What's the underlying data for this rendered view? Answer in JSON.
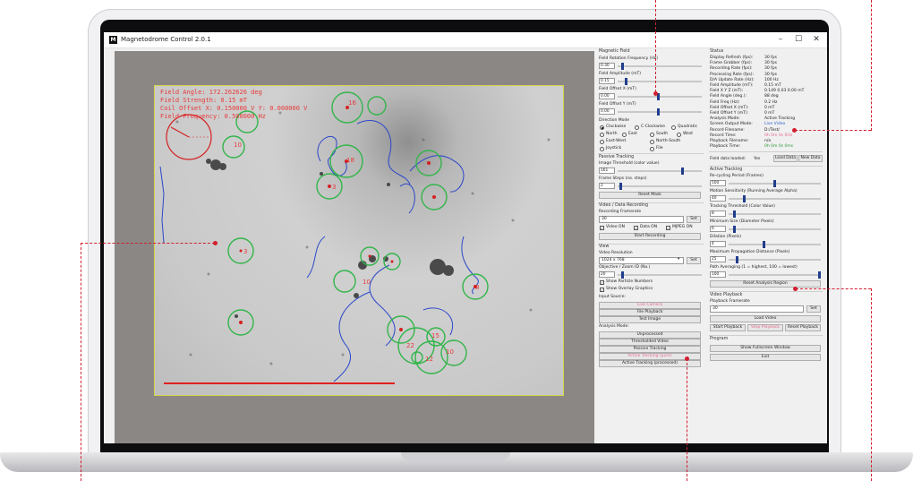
{
  "window": {
    "title": "Magnetodrome Control 2.0.1",
    "logo": "M",
    "minimize": "–",
    "maximize": "☐",
    "close": "✕"
  },
  "overlay": [
    "Field Angle: 172.262626 deg",
    "Field Strength: 0.15 mT",
    "Coil Offset X: 0.150000 V  Y: 0.000000 V",
    "Field Frequency: 0.500000 Hz"
  ],
  "particle_labels": [
    "16",
    "10",
    "18",
    "3",
    "10",
    "22",
    "15",
    "12",
    "10",
    "3",
    "8"
  ],
  "magnetic_field": {
    "title": "Magnetic Field",
    "rot_freq_label": "Field Rotation Frequency (Hz)",
    "rot_freq_value": "0.30",
    "amplitude_label": "Field Amplitude (mT)",
    "amplitude_value": "0.15",
    "offset_x_label": "Field Offset X (mT)",
    "offset_x_value": "0.00",
    "offset_y_label": "Field Offset Y (mT)",
    "offset_y_value": "0.00",
    "direction_label": "Direction Mode",
    "directions": [
      "Clockwise",
      "C-Clockwise",
      "Quadratic",
      "North",
      "East",
      "South",
      "West",
      "East-West",
      "North-South",
      "Joystick",
      "File"
    ]
  },
  "passive_tracking": {
    "title": "Passive Tracking",
    "threshold_label": "Image Threshold (color value)",
    "threshold_value": "161",
    "frame_steps_label": "Frame Steps (no. steps)",
    "frame_steps_value": "2",
    "reset_mask": "Reset Mask"
  },
  "recording": {
    "title": "Video / Data Recording",
    "framerate_label": "Recording Framerate",
    "framerate_value": "30",
    "set": "Set",
    "video_on": "Video ON",
    "data_on": "Data ON",
    "mjpeg_on": "MJPEG ON",
    "start": "Start Recording"
  },
  "view": {
    "title": "View",
    "resolution_label": "Video Resolution",
    "resolution_value": "1024 x 768",
    "set": "Set",
    "objective_label": "Objective / Zoom ID (No.)",
    "objective_value": "20",
    "show_numbers": "Show Particle Numbers",
    "show_overlay": "Show Overlay Graphics",
    "input_source": "Input Source:",
    "live_camera": "Live Camera",
    "file_playback": "File Playback",
    "test_image": "Test Image",
    "analysis_mode": "Analysis Mode:",
    "unprocessed": "Unprocessed",
    "thresholded": "Thresholded Video",
    "passive": "Passive Tracking",
    "active_pure": "Active Tracking (pure)",
    "active_processed": "Active Tracking (processed)"
  },
  "status": {
    "title": "Status",
    "rows": [
      [
        "Display Refresh (fps):",
        "30 fps"
      ],
      [
        "Frame Grabber (fps):",
        "30 fps"
      ],
      [
        "Recording Rate (fps):",
        "30 fps"
      ],
      [
        "Processing Rate (fps):",
        "30 fps"
      ],
      [
        "D/A Update Rate (Hz):",
        "100 Hz"
      ],
      [
        "Field Amplitude (mT):",
        "0.15 mT"
      ],
      [
        "Field X Y Z (mT):",
        "0.149 0.03 0.00 mT"
      ],
      [
        "Field Angle (deg.):",
        "88 deg"
      ],
      [
        "Field Freq (Hz):",
        "0.2 Hz"
      ],
      [
        "Field Offset X (mT):",
        "0 mT"
      ],
      [
        "Field Offset Y (mT):",
        "0 mT"
      ],
      [
        "Analysis Mode:",
        "Active Tracking"
      ],
      [
        "Screen Output Mode:",
        "Live Video"
      ],
      [
        "Record Filename:",
        "D:/Test/"
      ],
      [
        "Record Time:",
        "0h 0m 0s 0Hz"
      ],
      [
        "Playback Filename:",
        "n/a"
      ],
      [
        "Playback Time:",
        "0h 0m 0s 0ms"
      ]
    ],
    "data_loaded_label": "Field data loaded:",
    "data_loaded_value": "Yes",
    "load_data": "Load Data",
    "new_data": "New Data"
  },
  "active_tracking": {
    "title": "Active Tracking",
    "recycling_label": "Re-cycling Period (Frames)",
    "recycling_value": "500",
    "motion_label": "Motion Sensitivity (Running Average Alpha)",
    "motion_value": "40",
    "threshold_label": "Tracking Threshold (Color Value)",
    "threshold_value": "8",
    "minsize_label": "Minimum Size (Diameter Pixels)",
    "minsize_value": "6",
    "dilation_label": "Dilation (Pixels)",
    "dilation_value": "4",
    "maxprop_label": "Maximum Propagation Distance (Pixels)",
    "maxprop_value": "25",
    "pathavg_label": "Path Averaging (1 = highest, 100 = lowest)",
    "pathavg_value": "100",
    "reset": "Reset Analysis Region"
  },
  "playback": {
    "title": "Video Playback",
    "framerate_label": "Playback Framerate",
    "framerate_value": "30",
    "set": "Set",
    "load_video": "Load Video",
    "start": "Start Playback",
    "stop": "Stop Playback",
    "reset": "Reset Playback"
  },
  "program": {
    "title": "Program",
    "fullscreen": "Show Fullscreen Window",
    "exit": "Exit"
  }
}
